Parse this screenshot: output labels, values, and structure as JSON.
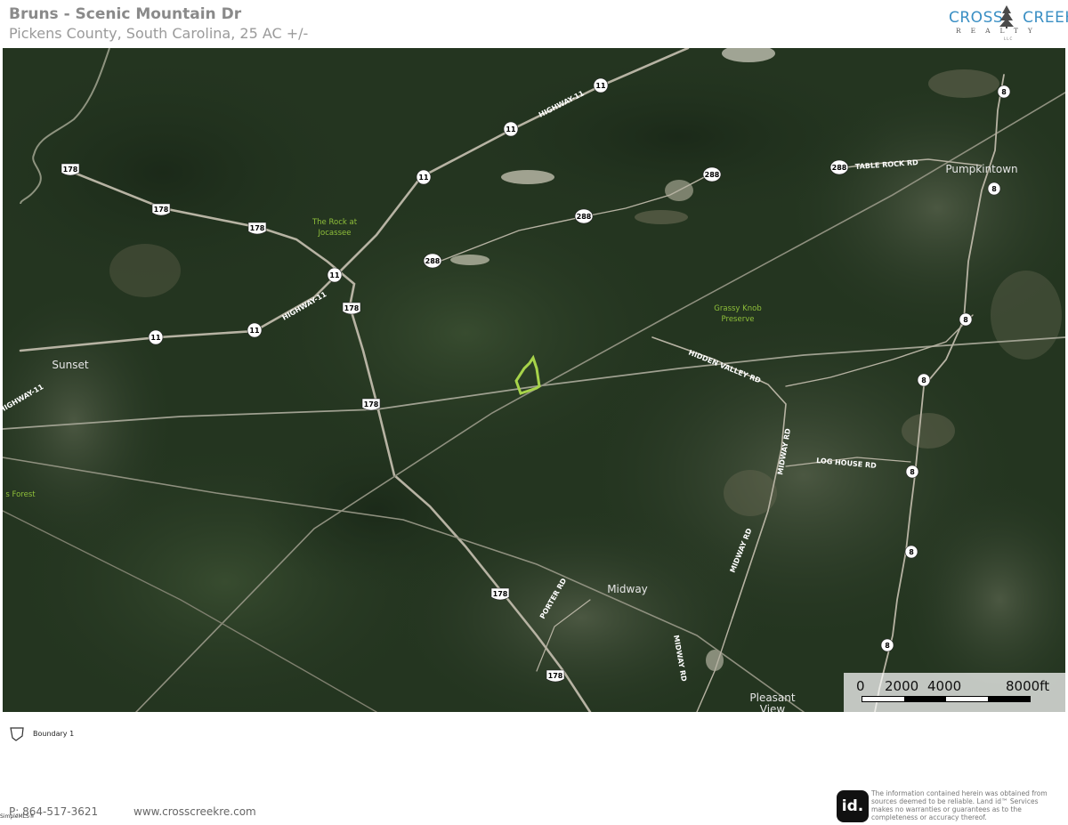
{
  "header": {
    "title": "Bruns - Scenic Mountain Dr",
    "subtitle": "Pickens County, South Carolina, 25 AC +/-"
  },
  "logo": {
    "name_left": "CROSS",
    "name_right": "CREEK",
    "tagline": "REALTY",
    "suffix": "LLC",
    "brand_color": "#3a8fc4"
  },
  "map": {
    "background_color": "#22331f",
    "road_color": "#b7b3a3",
    "boundary_color": "#a7d34a",
    "label_color": "#8fbf3a",
    "shields": [
      {
        "label": "11",
        "shape": "circle"
      },
      {
        "label": "11",
        "shape": "circle"
      },
      {
        "label": "11",
        "shape": "circle"
      },
      {
        "label": "11",
        "shape": "circle"
      },
      {
        "label": "11",
        "shape": "circle"
      },
      {
        "label": "11",
        "shape": "circle"
      },
      {
        "label": "178",
        "shape": "shield"
      },
      {
        "label": "178",
        "shape": "shield"
      },
      {
        "label": "178",
        "shape": "shield"
      },
      {
        "label": "178",
        "shape": "shield"
      },
      {
        "label": "178",
        "shape": "shield"
      },
      {
        "label": "178",
        "shape": "shield"
      },
      {
        "label": "178",
        "shape": "shield"
      },
      {
        "label": "288",
        "shape": "circle"
      },
      {
        "label": "288",
        "shape": "circle"
      },
      {
        "label": "288",
        "shape": "circle"
      },
      {
        "label": "288",
        "shape": "circle"
      },
      {
        "label": "8",
        "shape": "circle"
      },
      {
        "label": "8",
        "shape": "circle"
      },
      {
        "label": "8",
        "shape": "circle"
      },
      {
        "label": "8",
        "shape": "circle"
      },
      {
        "label": "8",
        "shape": "circle"
      },
      {
        "label": "8",
        "shape": "circle"
      },
      {
        "label": "8",
        "shape": "circle"
      }
    ],
    "road_labels": {
      "highway_11_a": "HIGHWAY-11",
      "highway_11_b": "HIGHWAY-11",
      "highway_11_c": "HIGHWAY-11",
      "table_rock": "TABLE ROCK RD",
      "hidden_valley": "HIDDEN VALLEY RD",
      "midway_a": "MIDWAY RD",
      "midway_b": "MIDWAY RD",
      "midway_c": "MIDWAY RD",
      "log_house": "LOG HOUSE RD",
      "porter": "PORTER RD"
    },
    "places": {
      "pumpkintown": "Pumpkintown",
      "sunset": "Sunset",
      "midway": "Midway",
      "pleasant_view_1": "Pleasant",
      "pleasant_view_2": "View"
    },
    "areas": {
      "rock_1": "The Rock at",
      "rock_2": "Jocassee",
      "grassy_1": "Grassy Knob",
      "grassy_2": "Preserve",
      "forest": "s Forest"
    }
  },
  "scale": {
    "labels": [
      "0",
      "2000",
      "4000",
      "8000ft"
    ]
  },
  "legend": {
    "label": "Boundary 1"
  },
  "footer": {
    "phone": "P: 864-517-3621",
    "website": "www.crosscreekre.com",
    "icon_text": "id.",
    "disclaimer": "The information contained herein was obtained from sources deemed to be reliable. Land id™ Services makes no warranties or guarantees as to the completeness or accuracy thereof.",
    "watermark": "SimpleMLS®"
  }
}
